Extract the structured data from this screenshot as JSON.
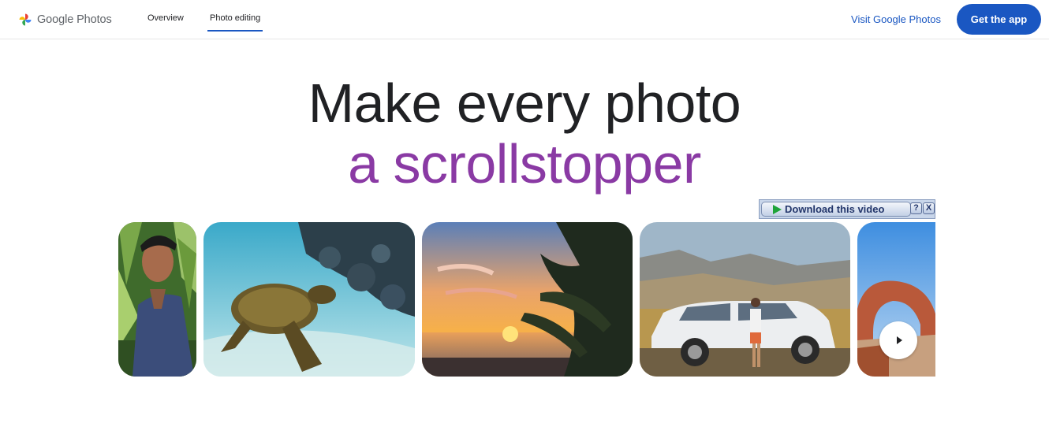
{
  "header": {
    "logo_text": "Google Photos",
    "nav": [
      {
        "label": "Overview"
      },
      {
        "label": "Photo editing",
        "active": true
      }
    ],
    "visit_label": "Visit Google Photos",
    "get_app_label": "Get the app"
  },
  "hero": {
    "line1": "Make every photo",
    "line2": "a scrollstopper"
  },
  "download_bar": {
    "label": "Download this video",
    "help": "?",
    "close": "X"
  },
  "photos": [
    {
      "name": "photo-man-jungle"
    },
    {
      "name": "photo-sea-turtle"
    },
    {
      "name": "photo-beach-sunset"
    },
    {
      "name": "photo-car-roadtrip"
    },
    {
      "name": "photo-rock-arch",
      "has_play": true
    }
  ],
  "icons": {
    "logo": "google-photos-pinwheel-icon",
    "play": "play-icon",
    "download": "download-play-icon"
  },
  "colors": {
    "accent": "#1a57c2",
    "headline": "#202124",
    "headline_accent": "#8a3aa4"
  }
}
